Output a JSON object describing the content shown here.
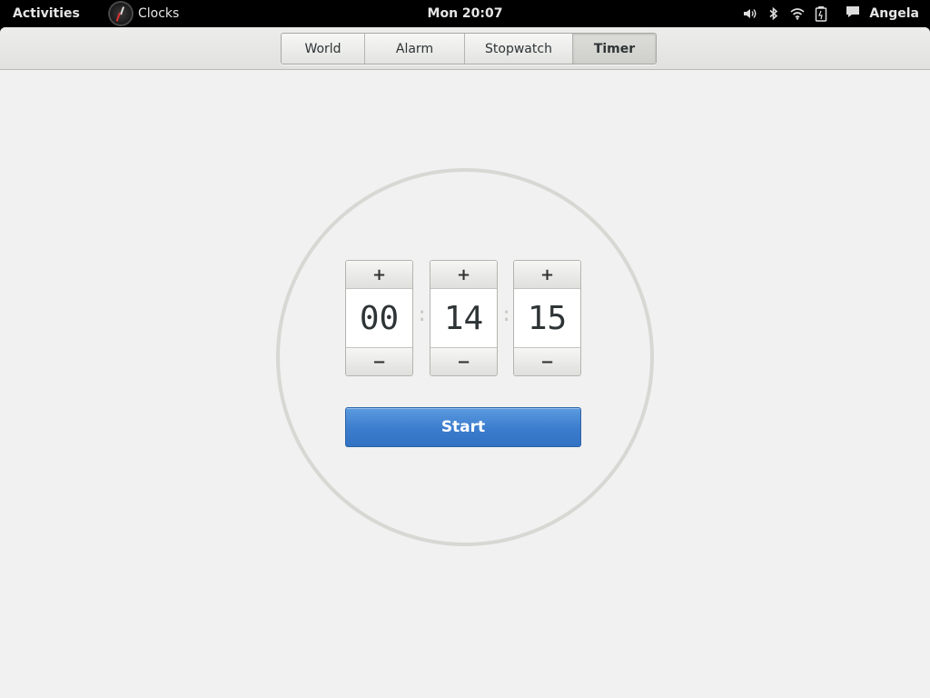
{
  "topbar": {
    "activities": "Activities",
    "app_name": "Clocks",
    "clock": "Mon 20:07",
    "user": "Angela",
    "icons": [
      "volume-icon",
      "bluetooth-icon",
      "wifi-icon",
      "battery-icon",
      "chat-icon"
    ]
  },
  "tabs": [
    {
      "label": "World",
      "active": false
    },
    {
      "label": "Alarm",
      "active": false
    },
    {
      "label": "Stopwatch",
      "active": false
    },
    {
      "label": "Timer",
      "active": true
    }
  ],
  "timer": {
    "hours": "00",
    "minutes": "14",
    "seconds": "15",
    "plus": "+",
    "minus": "−",
    "separator": ":",
    "start_label": "Start"
  },
  "colors": {
    "accent": "#3b7ccd",
    "ring": "#d7d7d3",
    "background": "#f1f1f1"
  }
}
